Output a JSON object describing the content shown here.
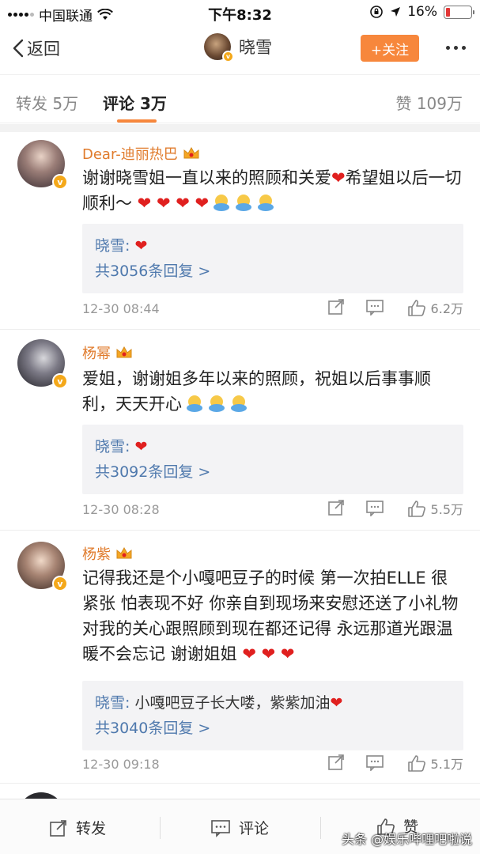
{
  "status_bar": {
    "carrier": "中国联通",
    "time": "下午8:32",
    "battery": "16%",
    "battery_level": 0.16
  },
  "nav": {
    "back_label": "返回",
    "user_name": "晓雪",
    "follow_label": "+关注"
  },
  "tabs": [
    {
      "label": "转发 5万"
    },
    {
      "label": "评论 3万"
    },
    {
      "label": "赞 109万"
    }
  ],
  "colors": {
    "accent": "#f7873c",
    "link": "#4f79ad",
    "name": "#e07b2c",
    "heart": "#e0201f"
  },
  "comments": [
    {
      "name": "Dear-迪丽热巴",
      "text": "谢谢晓雪姐一直以来的照顾和关爱",
      "text2": "希望姐以后一切顺利～",
      "reply_author": "晓雪:",
      "reply_text": "",
      "reply_count": "共3056条回复 >",
      "time": "12-30 08:44",
      "likes": "6.2万"
    },
    {
      "name": "杨幂",
      "text": "爱姐，谢谢姐多年以来的照顾，祝姐以后事事顺利，天天开心",
      "reply_author": "晓雪:",
      "reply_text": "",
      "reply_count": "共3092条回复 >",
      "time": "12-30 08:28",
      "likes": "5.5万"
    },
    {
      "name": "杨紫",
      "text": "记得我还是个小嘎吧豆子的时候 第一次拍ELLE 很紧张 怕表现不好 你亲自到现场来安慰还送了小礼物 对我的关心跟照顾到现在都还记得 永远那道光跟温暖不会忘记 谢谢姐姐",
      "reply_author": "晓雪:",
      "reply_text": "小嘎吧豆子长大喽，紫紫加油",
      "reply_count": "共3040条回复 >",
      "time": "12-30 09:18",
      "likes": "5.1万"
    }
  ],
  "bottom_bar": {
    "repost": "转发",
    "comment": "评论",
    "like": "赞"
  },
  "watermark": "头条 @娱乐哔哩吧啦说"
}
